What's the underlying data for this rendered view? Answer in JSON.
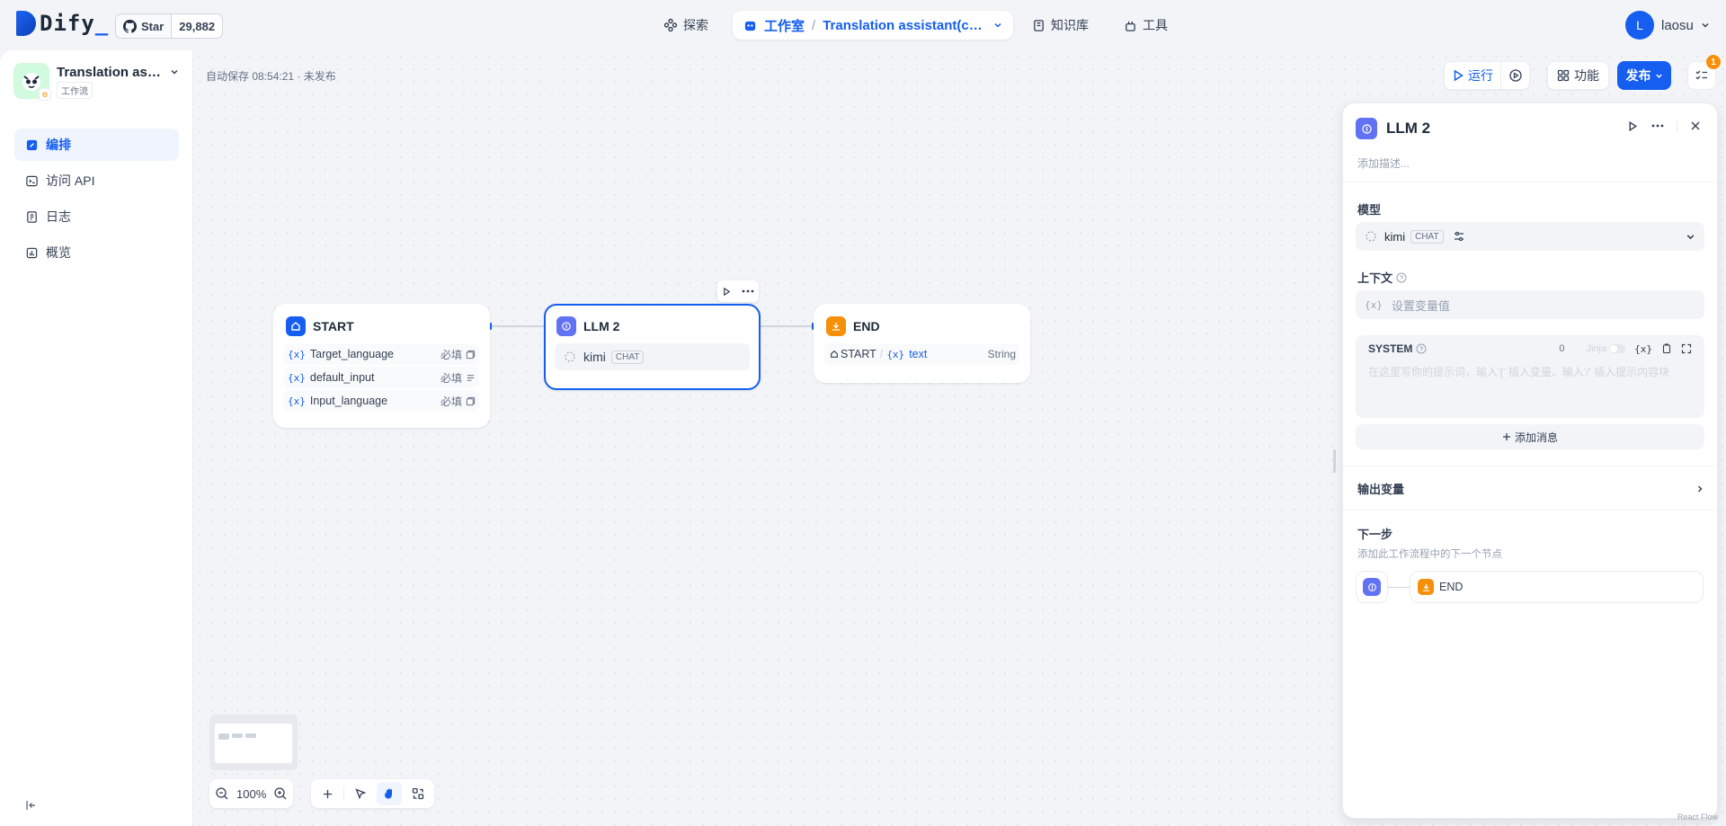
{
  "header": {
    "logo_text": "Dify",
    "github": {
      "star_label": "Star",
      "star_count": "29,882"
    },
    "nav": {
      "explore": "探索",
      "studio": "工作室",
      "separator": "/",
      "current_app": "Translation assistant(co...",
      "knowledge": "知识库",
      "tools": "工具"
    },
    "user": {
      "avatar_letter": "L",
      "name": "laosu"
    }
  },
  "sidebar": {
    "app_name": "Translation assis...",
    "app_type": "工作流",
    "items": [
      {
        "label": "编排",
        "icon": "edit-icon",
        "active": true
      },
      {
        "label": "访问 API",
        "icon": "terminal-icon",
        "active": false
      },
      {
        "label": "日志",
        "icon": "file-list-icon",
        "active": false
      },
      {
        "label": "概览",
        "icon": "bar-chart-icon",
        "active": false
      }
    ]
  },
  "toolbar": {
    "autosave": "自动保存 08:54:21 · 未发布",
    "run": "运行",
    "features": "功能",
    "publish": "发布",
    "checklist_count": "1"
  },
  "nodes": {
    "start": {
      "title": "START",
      "vars": [
        {
          "name": "Target_language",
          "required": "必填"
        },
        {
          "name": "default_input",
          "required": "必填"
        },
        {
          "name": "Input_language",
          "required": "必填"
        }
      ]
    },
    "llm": {
      "title": "LLM 2",
      "model": "kimi",
      "mode": "CHAT"
    },
    "end": {
      "title": "END",
      "source_node": "START",
      "var_name": "text",
      "var_type": "String"
    }
  },
  "var_prefix": "{x}",
  "zoom": {
    "level": "100%"
  },
  "panel": {
    "title": "LLM 2",
    "description_placeholder": "添加描述...",
    "model_label": "模型",
    "model_name": "kimi",
    "model_mode": "CHAT",
    "context_label": "上下文",
    "context_placeholder": "设置变量值",
    "system_label": "SYSTEM",
    "system_count": "0",
    "jinja_label": "Jinja",
    "system_placeholder": "在这里写你的提示词，输入'{' 插入变量、输入'/' 插入提示内容块",
    "add_message": "添加消息",
    "output_vars_label": "输出变量",
    "next_step_label": "下一步",
    "next_step_desc": "添加此工作流程中的下一个节点",
    "next_node": "END"
  },
  "footer": {
    "corner_text": "React Flow"
  },
  "colors": {
    "primary": "#155eef",
    "llm": "#6172f3",
    "end": "#f79009",
    "start": "#155eef"
  }
}
